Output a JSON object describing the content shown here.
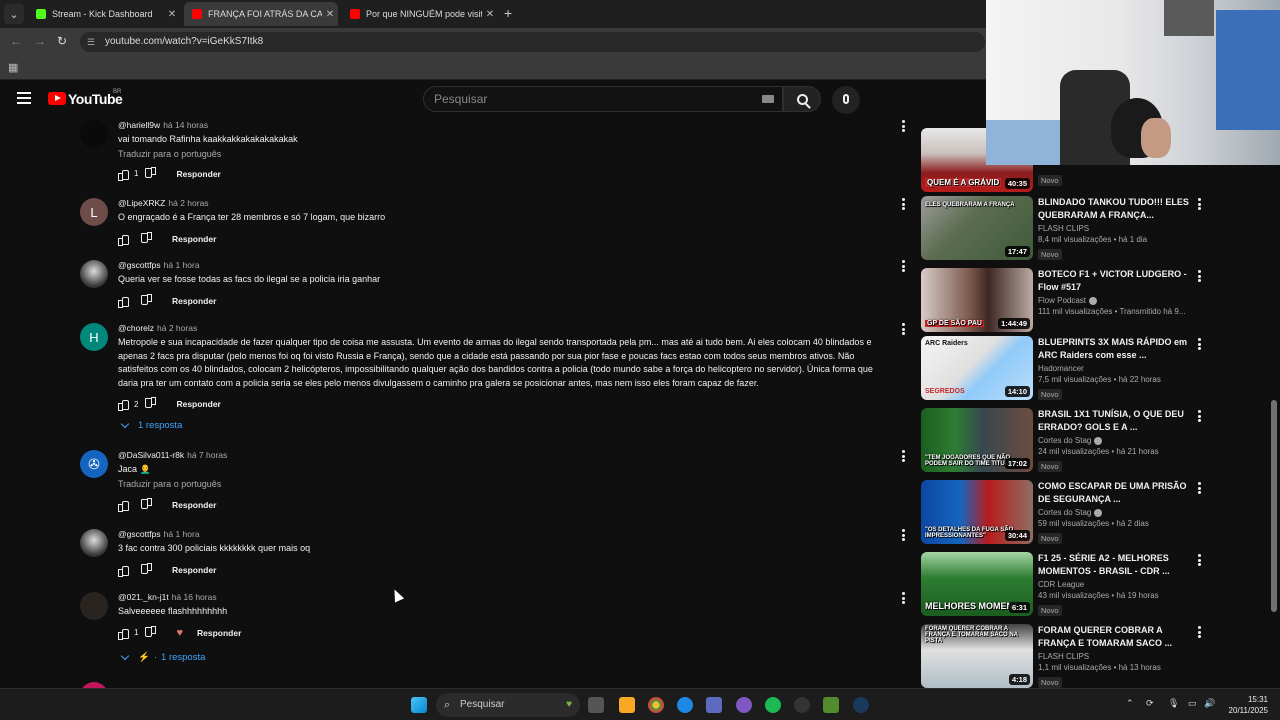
{
  "browser": {
    "tabs": [
      {
        "title": "Stream - Kick Dashboard"
      },
      {
        "title": "FRANÇA FOI ATRÁS DA CARGA"
      },
      {
        "title": "Por que NINGUÉM pode visitar"
      }
    ],
    "url": "youtube.com/watch?v=iGeKkS7Itk8"
  },
  "youtube": {
    "logo_text": "YouTube",
    "country": "BR",
    "search_placeholder": "Pesquisar"
  },
  "labels": {
    "reply": "Responder"
  },
  "comments": [
    {
      "author": "@hariell9w",
      "time": "há 14 horas",
      "text": "vai tomando Rafinha kaakkakkakakakakakak",
      "translate": "Traduzir para o português",
      "likes": "1"
    },
    {
      "author": "@LipeXRKZ",
      "time": "há 2 horas",
      "initial": "L",
      "text": "O engraçado é a França ter 28 membros e só 7 logam, que bizarro"
    },
    {
      "author": "@gscottfps",
      "time": "há 1 hora",
      "text": "Queria ver se fosse todas as facs do ilegal se a policia iria ganhar"
    },
    {
      "author": "@chorelz",
      "time": "há 2 horas",
      "initial": "H",
      "text": "Metropole e sua incapacidade de fazer qualquer tipo de coisa me assusta. Um evento de armas do ilegal sendo transportada pela pm... mas até ai tudo bem. Ai eles colocam 40 blindados e apenas 2 facs pra disputar (pelo menos foi oq foi visto Russia e França), sendo que a cidade está passando por sua pior fase e poucas facs estao com todos seus membros ativos. Não satisfeitos com os 40 blindados, colocam 2 helicópteros, impossibilitando qualquer ação dos bandidos contra a policia (todo mundo sabe a força do helicoptero no servidor). Única forma que daria pra ter um contato com a policia seria se eles pelo menos divulgassem o caminho pra galera se posicionar antes, mas nem isso eles foram capaz de fazer.",
      "likes": "2",
      "replies": "1 resposta"
    },
    {
      "author": "@DaSilva011-r8k",
      "time": "há 7 horas",
      "text": "Jaca 👨‍🦲",
      "translate": "Traduzir para o português"
    },
    {
      "author": "@gscottfps",
      "time": "há 1 hora",
      "text": "3 fac contra 300 policiais kkkkkkkk quer mais oq"
    },
    {
      "author": "@021._kn-j1t",
      "time": "há 16 horas",
      "text": "Salveeeeee flashhhhhhhhh",
      "likes": "1",
      "replies": "1 resposta"
    }
  ],
  "sidebar": {
    "videos": [
      {
        "thumb_text": "QUEM É A GRÁVID",
        "duration": "40:35",
        "badge": "Novo"
      },
      {
        "thumb_text": "ELES QUEBRARAM A FRANÇA",
        "duration": "17:47",
        "title": "BLINDADO TANKOU TUDO!!! ELES QUEBRARAM A FRANÇA...",
        "channel": "FLASH CLIPS",
        "stats": "8,4 mil visualizações • há 1 dia",
        "badge": "Novo"
      },
      {
        "thumb_text": "GP DE SÃO PAU",
        "duration": "1:44:49",
        "title": "BOTECO F1 + VICTOR LUDGERO - Flow #517",
        "channel": "Flow Podcast",
        "stats": "111 mil visualizações • Transmitido há 9..."
      },
      {
        "thumb_text": "ARC Raiders",
        "thumb_text2": "SEGREDOS",
        "duration": "14:10",
        "title": "BLUEPRINTS 3X MAIS RÁPIDO em ARC Raiders com esse ...",
        "channel": "Hadomancer",
        "stats": "7,5 mil visualizações • há 22 horas",
        "badge": "Novo"
      },
      {
        "thumb_text": "\"TEM JOGADORES QUE NÃO PODEM SAIR DO TIME TITULAR\"",
        "duration": "17:02",
        "title": "BRASIL 1X1 TUNÍSIA, O QUE DEU ERRADO? GOLS E A ...",
        "channel": "Cortes do Stag",
        "stats": "24 mil visualizações • há 21 horas",
        "badge": "Novo"
      },
      {
        "thumb_text": "\"OS DETALHES DA FUGA SÃO IMPRESSIONANTES\"",
        "duration": "30:44",
        "title": "COMO ESCAPAR DE UMA PRISÃO DE SEGURANÇA ...",
        "channel": "Cortes do Stag",
        "stats": "59 mil visualizações • há 2 dias",
        "badge": "Novo"
      },
      {
        "thumb_text": "MELHORES MOMENT",
        "duration": "6:31",
        "title": "F1 25 - SÉRIE A2 - MELHORES MOMENTOS - BRASIL - CDR ...",
        "channel": "CDR League",
        "stats": "43 mil visualizações • há 19 horas",
        "badge": "Novo"
      },
      {
        "thumb_text": "FORAM QUERER COBRAR A FRANÇA E TOMARAM SACO NA PISTA",
        "duration": "4:18",
        "title": "FORAM QUERER COBRAR A FRANÇA E TOMARAM SACO ...",
        "channel": "FLASH CLIPS",
        "stats": "1,1 mil visualizações • há 13 horas",
        "badge": "Novo"
      }
    ]
  },
  "taskbar": {
    "search_label": "Pesquisar",
    "time": "15:31",
    "date": "20/11/2025"
  }
}
